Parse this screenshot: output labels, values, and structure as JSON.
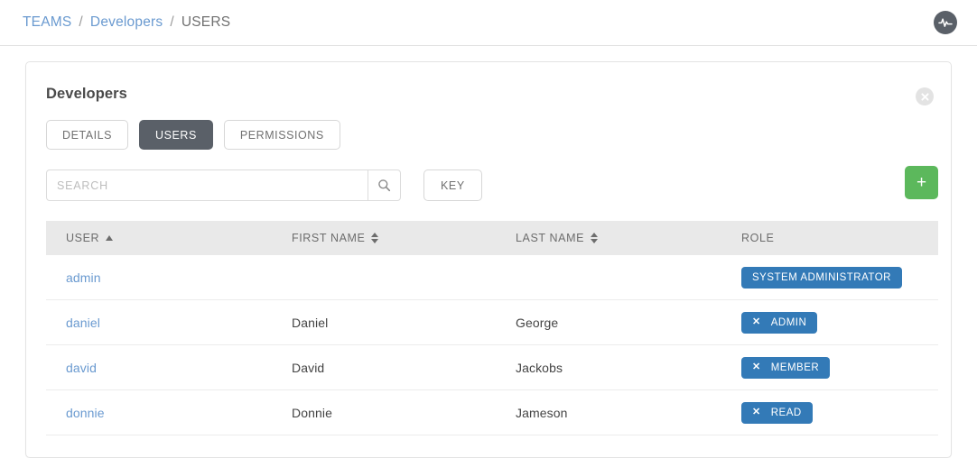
{
  "breadcrumb": {
    "items": [
      {
        "label": "TEAMS",
        "type": "link"
      },
      {
        "label": "Developers",
        "type": "link"
      },
      {
        "label": "USERS",
        "type": "current"
      }
    ],
    "separator": "/"
  },
  "topbar": {
    "activity_icon": "activity-stream-icon"
  },
  "card": {
    "title": "Developers",
    "close_icon": "×",
    "tabs": [
      {
        "label": "DETAILS",
        "active": false
      },
      {
        "label": "USERS",
        "active": true
      },
      {
        "label": "PERMISSIONS",
        "active": false
      }
    ],
    "toolbar": {
      "search_value": "",
      "search_placeholder": "SEARCH",
      "search_icon": "search-icon",
      "key_label": "KEY",
      "add_label": "+"
    },
    "table": {
      "columns": [
        {
          "label": "USER",
          "sort": "asc"
        },
        {
          "label": "FIRST NAME",
          "sort": "both"
        },
        {
          "label": "LAST NAME",
          "sort": "both"
        },
        {
          "label": "ROLE",
          "sort": "none"
        }
      ],
      "rows": [
        {
          "user": "admin",
          "first_name": "",
          "last_name": "",
          "role": {
            "label": "SYSTEM ADMINISTRATOR",
            "removable": false,
            "color": "#337ab7"
          }
        },
        {
          "user": "daniel",
          "first_name": "Daniel",
          "last_name": "George",
          "role": {
            "label": "ADMIN",
            "removable": true,
            "color": "#337ab7"
          }
        },
        {
          "user": "david",
          "first_name": "David",
          "last_name": "Jackobs",
          "role": {
            "label": "MEMBER",
            "removable": true,
            "color": "#337ab7"
          }
        },
        {
          "user": "donnie",
          "first_name": "Donnie",
          "last_name": "Jameson",
          "role": {
            "label": "READ",
            "removable": true,
            "color": "#337ab7"
          }
        }
      ]
    }
  },
  "colors": {
    "link": "#6a9ad0",
    "tab_active_bg": "#5a6068",
    "badge_blue": "#337ab7",
    "add_green": "#5cb85c",
    "header_gray": "#e9e9e9"
  }
}
